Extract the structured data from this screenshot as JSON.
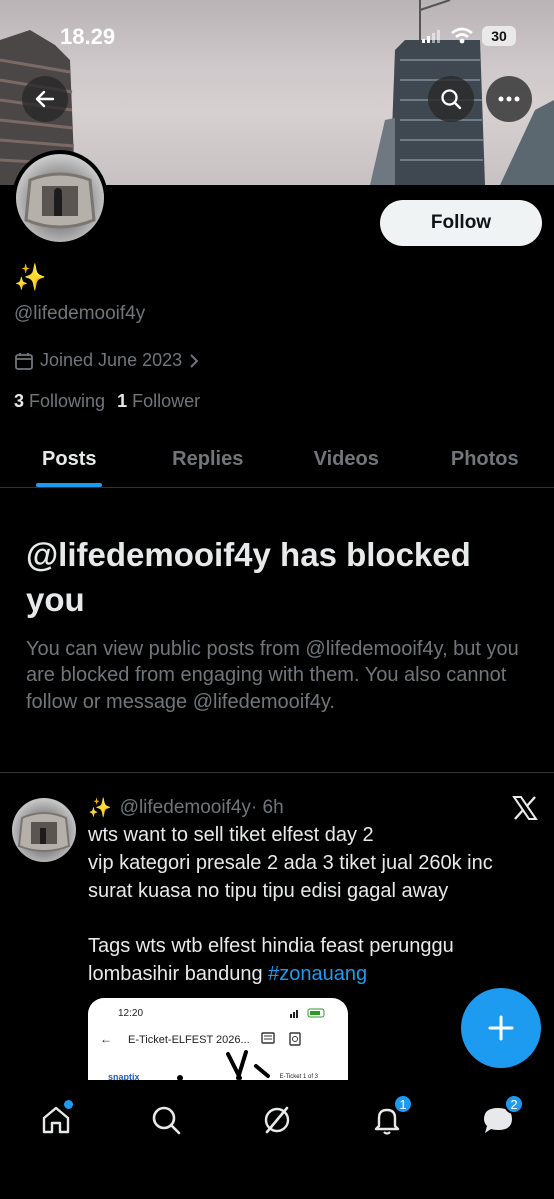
{
  "status_bar": {
    "time": "18.29",
    "battery": "30"
  },
  "profile": {
    "display_name": "✨",
    "handle": "@lifedemooif4y",
    "joined": "Joined June 2023",
    "following_count": "3",
    "following_label": "Following",
    "follower_count": "1",
    "follower_label": "Follower",
    "follow_label": "Follow"
  },
  "tabs": [
    {
      "label": "Posts",
      "active": true
    },
    {
      "label": "Replies",
      "active": false
    },
    {
      "label": "Videos",
      "active": false
    },
    {
      "label": "Photos",
      "active": false
    }
  ],
  "blocked": {
    "title": "@lifedemooif4y has blocked you",
    "body": "You can view public posts from @lifedemooif4y, but you are blocked from engaging with them. You also cannot follow or message @lifedemooif4y."
  },
  "post": {
    "name": "✨",
    "handle": "@lifedemooif4y",
    "time": "· 6h",
    "text": "wts want to sell tiket elfest day 2\nvip kategori presale 2 ada 3 tiket jual 260k inc surat kuasa no tipu tipu edisi gagal away\n\nTags wts wtb elfest hindia feast perunggu lombasihir bandung ",
    "hashtag": "#zonauang",
    "media": {
      "time": "12:20",
      "title": "E-Ticket-ELFEST 2026...",
      "brand": "snaptix",
      "sub": "E-Ticket 1 of 3"
    }
  },
  "nav": {
    "notifications_badge": "1",
    "messages_badge": "2"
  },
  "colors": {
    "accent": "#1d9bf0",
    "text": "#e7e9ea",
    "muted": "#71767b",
    "border": "#2f3336"
  }
}
